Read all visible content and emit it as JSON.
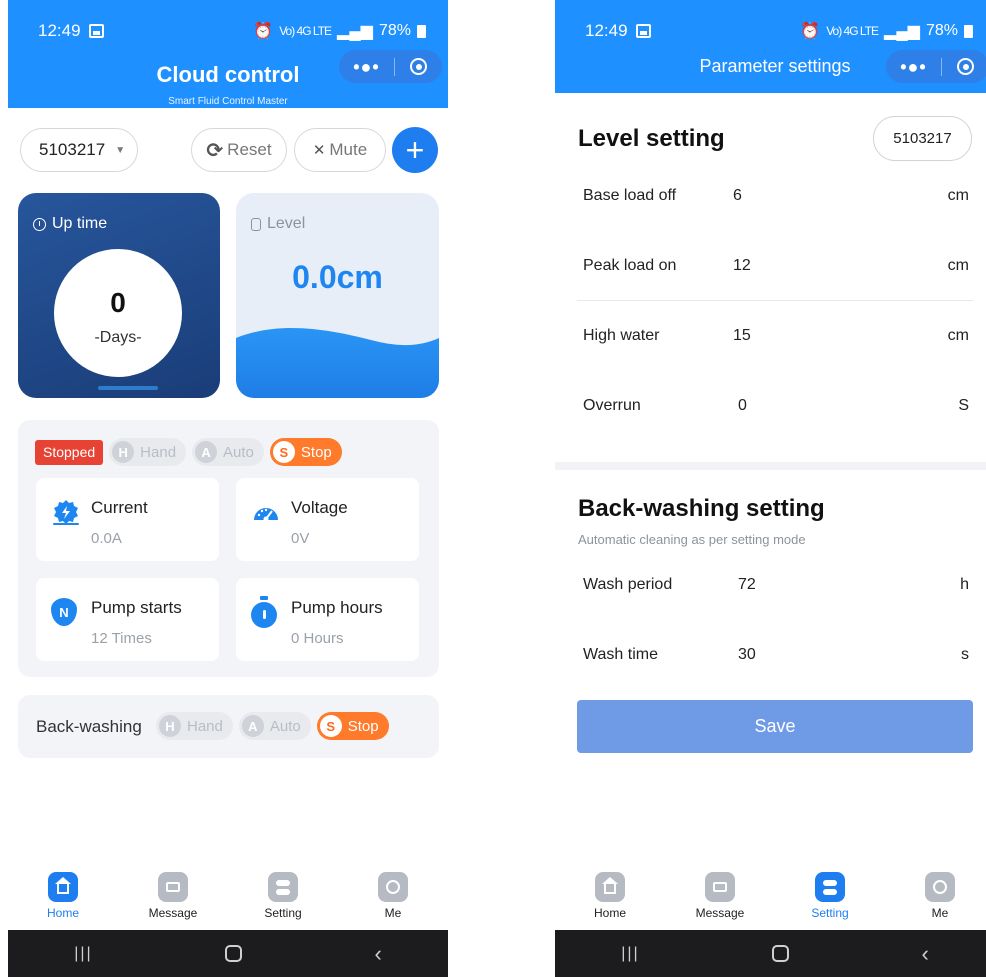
{
  "status_bar": {
    "time": "12:49",
    "battery": "78%",
    "signal": "Vo) 4G LTE"
  },
  "left": {
    "header": {
      "title": "Cloud control",
      "subtitle": "Smart Fluid Control Master"
    },
    "toolbar": {
      "device_id": "5103217",
      "reset_label": "Reset",
      "mute_label": "Mute"
    },
    "uptime": {
      "label": "Up time",
      "value": "0",
      "unit": "-Days-"
    },
    "level": {
      "label": "Level",
      "value": "0.0cm"
    },
    "status": {
      "badge": "Stopped",
      "modes": [
        {
          "letter": "H",
          "label": "Hand",
          "active": false
        },
        {
          "letter": "A",
          "label": "Auto",
          "active": false
        },
        {
          "letter": "S",
          "label": "Stop",
          "active": true
        }
      ]
    },
    "metrics": {
      "current": {
        "title": "Current",
        "value": "0.0A"
      },
      "voltage": {
        "title": "Voltage",
        "value": "0V"
      },
      "starts": {
        "title": "Pump starts",
        "value": "12 Times",
        "icon_letter": "N"
      },
      "hours": {
        "title": "Pump hours",
        "value": "0 Hours"
      }
    },
    "backwashing": {
      "label": "Back-washing",
      "modes": [
        {
          "letter": "H",
          "label": "Hand",
          "active": false
        },
        {
          "letter": "A",
          "label": "Auto",
          "active": false
        },
        {
          "letter": "S",
          "label": "Stop",
          "active": true
        }
      ]
    },
    "tabs": {
      "home": "Home",
      "message": "Message",
      "setting": "Setting",
      "me": "Me",
      "active": "home"
    }
  },
  "right": {
    "header": {
      "title": "Parameter settings"
    },
    "level_setting": {
      "title": "Level setting",
      "device_id": "5103217",
      "rows": [
        {
          "name": "Base load off",
          "value": "6",
          "unit": "cm"
        },
        {
          "name": "Peak load on",
          "value": "12",
          "unit": "cm"
        },
        {
          "name": "High water",
          "value": "15",
          "unit": "cm"
        },
        {
          "name": "Overrun",
          "value": "0",
          "unit": "S"
        }
      ]
    },
    "backwash_setting": {
      "title": "Back-washing setting",
      "subtitle": "Automatic cleaning as per setting mode",
      "rows": [
        {
          "name": "Wash period",
          "value": "72",
          "unit": "h"
        },
        {
          "name": "Wash time",
          "value": "30",
          "unit": "s"
        }
      ]
    },
    "save_label": "Save",
    "tabs": {
      "home": "Home",
      "message": "Message",
      "setting": "Setting",
      "me": "Me",
      "active": "setting"
    }
  },
  "colors": {
    "brand_blue": "#1e90ff",
    "accent_blue": "#1e7ef0",
    "stop_orange": "#ff7a2b",
    "stopped_red": "#e64335",
    "save_blue": "#6f9be6"
  }
}
